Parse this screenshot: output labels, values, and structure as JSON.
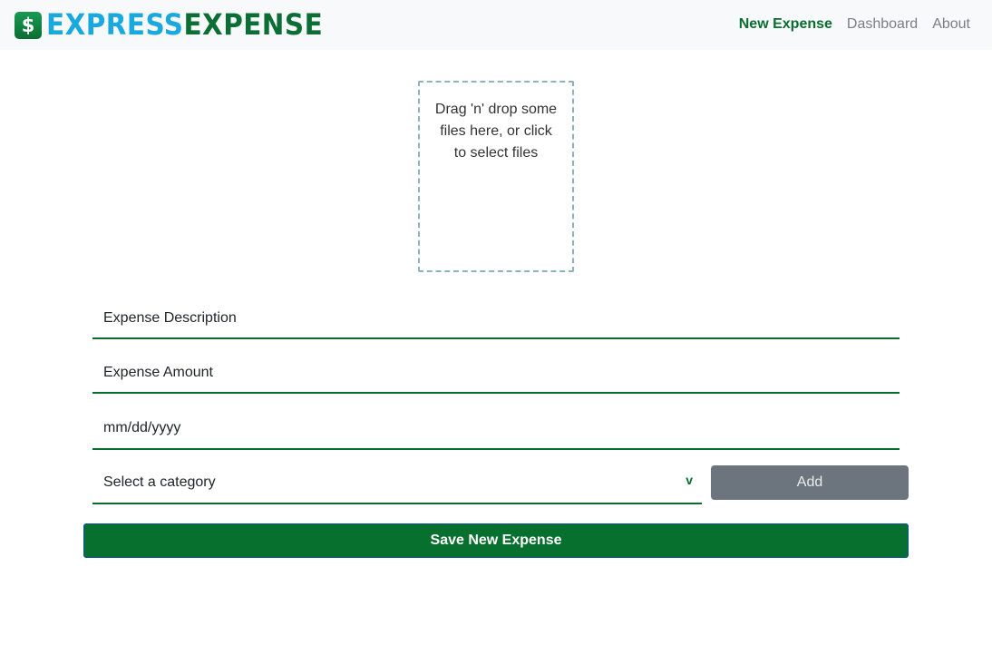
{
  "brand": {
    "icon": "dollar-receipt-icon",
    "icon_glyph": "$",
    "name_part1": "EXPRESS",
    "name_part2": "EXPENSE",
    "color_part1": "#1aa9df",
    "color_part2": "#0b6e35"
  },
  "nav": {
    "items": [
      {
        "label": "New Expense",
        "active": true
      },
      {
        "label": "Dashboard",
        "active": false
      },
      {
        "label": "About",
        "active": false
      }
    ]
  },
  "dropzone": {
    "text": "Drag 'n' drop some files here, or click to select files"
  },
  "form": {
    "description": {
      "placeholder": "Expense Description",
      "value": ""
    },
    "amount": {
      "placeholder": "Expense Amount",
      "value": ""
    },
    "date": {
      "placeholder": "mm/dd/yyyy",
      "value": ""
    },
    "category": {
      "selected": "Select a category",
      "arrow": "v"
    },
    "add_label": "Add",
    "save_label": "Save New Expense"
  },
  "colors": {
    "accent": "#0a6d30",
    "add_button": "#6c757d",
    "save_button": "#08702e",
    "navbar_bg": "#f8f9fa"
  }
}
